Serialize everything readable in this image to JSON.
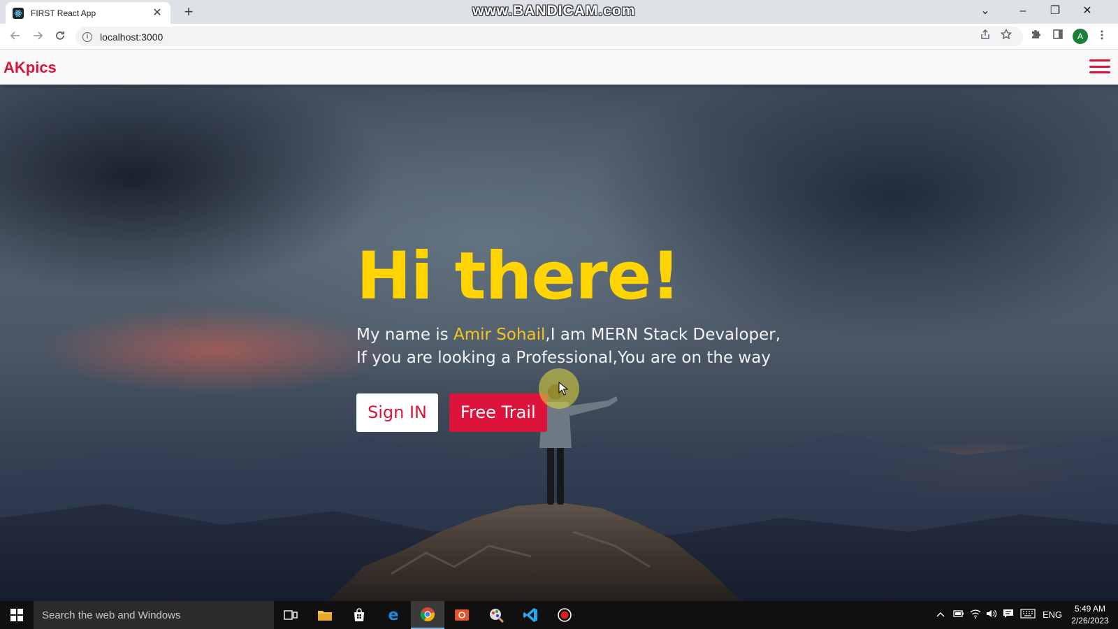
{
  "browser": {
    "tab": {
      "title": "FIRST React App",
      "close_glyph": "✕",
      "favicon": "react-favicon"
    },
    "new_tab_glyph": "+",
    "url": "localhost:3000",
    "watermark": "www.BANDICAM.com",
    "profile_initial": "A",
    "window_controls": {
      "dropdown": "⌄",
      "minimize": "–",
      "restore": "❐",
      "close": "✕"
    }
  },
  "app": {
    "brand": "AKpics",
    "accent_color": "#dc143c",
    "hero": {
      "title": "Hi there!",
      "line1_prefix": "My name is ",
      "name": "Amir Sohail",
      "line1_suffix": ",I am MERN Stack Devaloper,",
      "line2": "If you are looking a Professional,You are on the way",
      "buttons": {
        "signin": "Sign IN",
        "trial": "Free Trail"
      }
    }
  },
  "taskbar": {
    "search_placeholder": "Search the web and Windows",
    "language": "ENG",
    "time": "5:49 AM",
    "date": "2/26/2023",
    "pinned_icons": [
      "task-view-icon",
      "file-explorer-icon",
      "store-icon",
      "edge-icon",
      "chrome-icon",
      "photos-icon",
      "paint-icon",
      "vscode-icon",
      "bandicam-record-icon"
    ]
  },
  "colors": {
    "title_yellow": "#ffd400",
    "name_yellow": "#f5c518",
    "crimson": "#dc143c"
  }
}
